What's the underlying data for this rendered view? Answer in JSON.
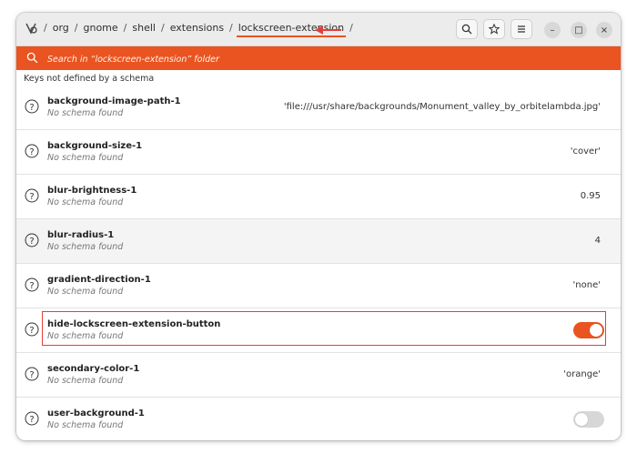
{
  "window": {
    "path": {
      "segments": [
        "org",
        "gnome",
        "shell",
        "extensions",
        "lockscreen-extension"
      ],
      "separator": "/"
    },
    "controls": {
      "search": "search-icon",
      "bookmark": "star-icon",
      "menu": "hamburger-icon",
      "minimize": "–",
      "maximize": "□",
      "close": "×"
    }
  },
  "search": {
    "placeholder": "Search in “lockscreen-extension” folder"
  },
  "section_title": "Keys not defined by a schema",
  "rows": [
    {
      "key": "background-image-path-1",
      "schema": "No schema found",
      "value": "'file:///usr/share/backgrounds/Monument_valley_by_orbitelambda.jpg'"
    },
    {
      "key": "background-size-1",
      "schema": "No schema found",
      "value": "'cover'"
    },
    {
      "key": "blur-brightness-1",
      "schema": "No schema found",
      "value": "0.95"
    },
    {
      "key": "blur-radius-1",
      "schema": "No schema found",
      "value": "4"
    },
    {
      "key": "gradient-direction-1",
      "schema": "No schema found",
      "value": "'none'"
    },
    {
      "key": "hide-lockscreen-extension-button",
      "schema": "No schema found",
      "toggle": true
    },
    {
      "key": "secondary-color-1",
      "schema": "No schema found",
      "value": "'orange'"
    },
    {
      "key": "user-background-1",
      "schema": "No schema found",
      "toggle": false
    }
  ],
  "colors": {
    "accent": "#e95420",
    "annotation": "#e0403a"
  }
}
